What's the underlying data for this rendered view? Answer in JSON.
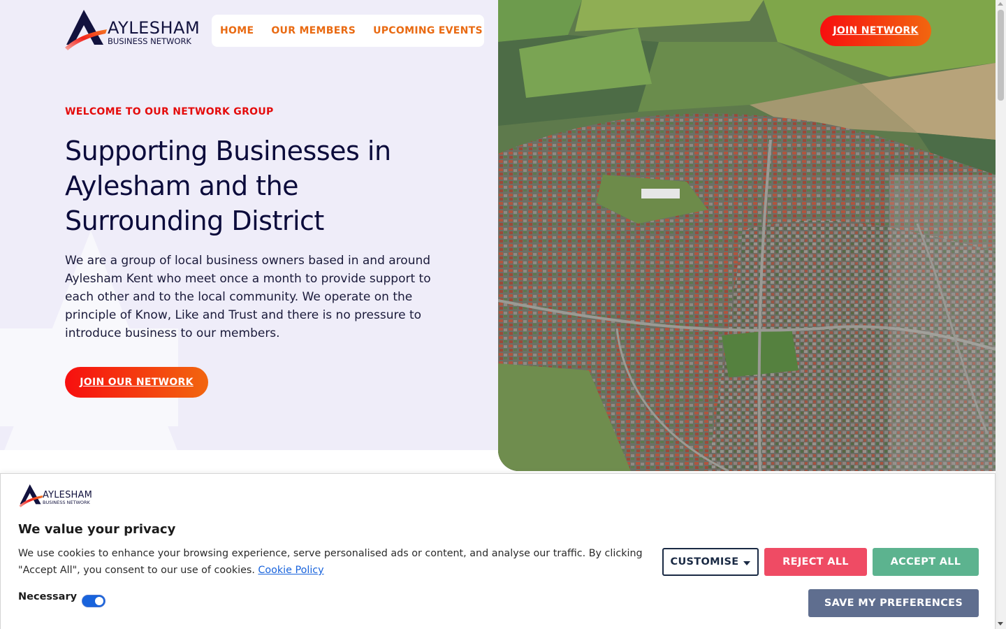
{
  "brand": {
    "name": "AYLESHAM",
    "tagline": "BUSINESS NETWORK"
  },
  "nav": {
    "items": [
      "HOME",
      "OUR MEMBERS",
      "UPCOMING EVENTS"
    ],
    "join_label": "JOIN NETWORK"
  },
  "hero": {
    "eyebrow": "WELCOME TO OUR NETWORK GROUP",
    "headline": "Supporting Businesses in Aylesham and the Surrounding District",
    "intro": "We are a group of local business owners based in and around Aylesham Kent who meet once a month to provide support to each other and to the local community.  We operate on the principle of Know, Like and Trust and there is no pressure to introduce business to our members.",
    "cta_label": "JOIN OUR NETWORK"
  },
  "cookie_banner": {
    "title": "We value your privacy",
    "text": "We use cookies to enhance your browsing experience, serve personalised ads or content, and analyse our traffic. By clicking \"Accept All\", you consent to our use of cookies.",
    "policy_link": "Cookie Policy",
    "necessary_label": "Necessary",
    "necessary_enabled": true,
    "buttons": {
      "customise": "CUSTOMISE",
      "reject": "REJECT ALL",
      "accept": "ACCEPT ALL",
      "save": "SAVE MY PREFERENCES"
    }
  },
  "colors": {
    "accent_orange": "#e96a12",
    "accent_red": "#e40c0c",
    "navy": "#0b0b3b",
    "hero_bg": "#efedf9",
    "reject": "#ef4b64",
    "accept": "#5cb38f",
    "save": "#5f6e8f"
  }
}
